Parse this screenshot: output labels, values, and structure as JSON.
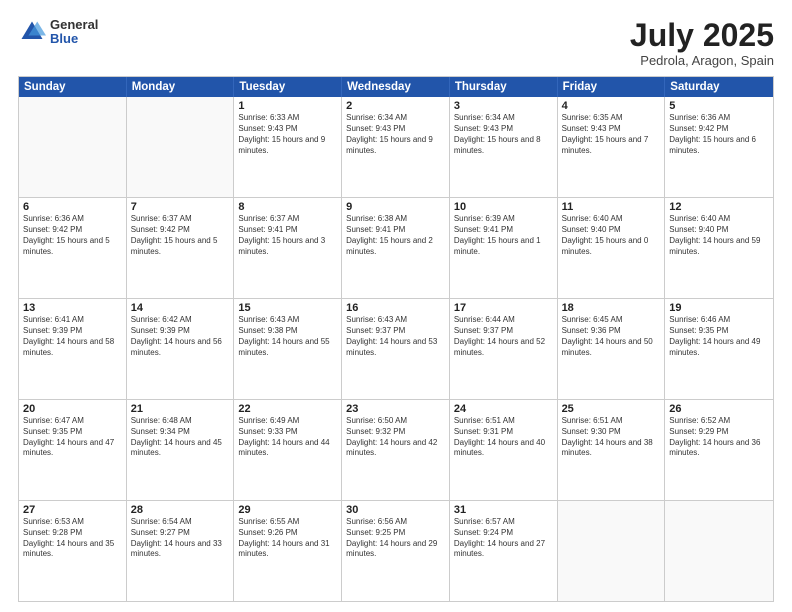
{
  "logo": {
    "general": "General",
    "blue": "Blue"
  },
  "title": {
    "month": "July 2025",
    "location": "Pedrola, Aragon, Spain"
  },
  "calendar": {
    "headers": [
      "Sunday",
      "Monday",
      "Tuesday",
      "Wednesday",
      "Thursday",
      "Friday",
      "Saturday"
    ],
    "rows": [
      [
        {
          "day": "",
          "text": ""
        },
        {
          "day": "",
          "text": ""
        },
        {
          "day": "1",
          "text": "Sunrise: 6:33 AM\nSunset: 9:43 PM\nDaylight: 15 hours and 9 minutes."
        },
        {
          "day": "2",
          "text": "Sunrise: 6:34 AM\nSunset: 9:43 PM\nDaylight: 15 hours and 9 minutes."
        },
        {
          "day": "3",
          "text": "Sunrise: 6:34 AM\nSunset: 9:43 PM\nDaylight: 15 hours and 8 minutes."
        },
        {
          "day": "4",
          "text": "Sunrise: 6:35 AM\nSunset: 9:43 PM\nDaylight: 15 hours and 7 minutes."
        },
        {
          "day": "5",
          "text": "Sunrise: 6:36 AM\nSunset: 9:42 PM\nDaylight: 15 hours and 6 minutes."
        }
      ],
      [
        {
          "day": "6",
          "text": "Sunrise: 6:36 AM\nSunset: 9:42 PM\nDaylight: 15 hours and 5 minutes."
        },
        {
          "day": "7",
          "text": "Sunrise: 6:37 AM\nSunset: 9:42 PM\nDaylight: 15 hours and 5 minutes."
        },
        {
          "day": "8",
          "text": "Sunrise: 6:37 AM\nSunset: 9:41 PM\nDaylight: 15 hours and 3 minutes."
        },
        {
          "day": "9",
          "text": "Sunrise: 6:38 AM\nSunset: 9:41 PM\nDaylight: 15 hours and 2 minutes."
        },
        {
          "day": "10",
          "text": "Sunrise: 6:39 AM\nSunset: 9:41 PM\nDaylight: 15 hours and 1 minute."
        },
        {
          "day": "11",
          "text": "Sunrise: 6:40 AM\nSunset: 9:40 PM\nDaylight: 15 hours and 0 minutes."
        },
        {
          "day": "12",
          "text": "Sunrise: 6:40 AM\nSunset: 9:40 PM\nDaylight: 14 hours and 59 minutes."
        }
      ],
      [
        {
          "day": "13",
          "text": "Sunrise: 6:41 AM\nSunset: 9:39 PM\nDaylight: 14 hours and 58 minutes."
        },
        {
          "day": "14",
          "text": "Sunrise: 6:42 AM\nSunset: 9:39 PM\nDaylight: 14 hours and 56 minutes."
        },
        {
          "day": "15",
          "text": "Sunrise: 6:43 AM\nSunset: 9:38 PM\nDaylight: 14 hours and 55 minutes."
        },
        {
          "day": "16",
          "text": "Sunrise: 6:43 AM\nSunset: 9:37 PM\nDaylight: 14 hours and 53 minutes."
        },
        {
          "day": "17",
          "text": "Sunrise: 6:44 AM\nSunset: 9:37 PM\nDaylight: 14 hours and 52 minutes."
        },
        {
          "day": "18",
          "text": "Sunrise: 6:45 AM\nSunset: 9:36 PM\nDaylight: 14 hours and 50 minutes."
        },
        {
          "day": "19",
          "text": "Sunrise: 6:46 AM\nSunset: 9:35 PM\nDaylight: 14 hours and 49 minutes."
        }
      ],
      [
        {
          "day": "20",
          "text": "Sunrise: 6:47 AM\nSunset: 9:35 PM\nDaylight: 14 hours and 47 minutes."
        },
        {
          "day": "21",
          "text": "Sunrise: 6:48 AM\nSunset: 9:34 PM\nDaylight: 14 hours and 45 minutes."
        },
        {
          "day": "22",
          "text": "Sunrise: 6:49 AM\nSunset: 9:33 PM\nDaylight: 14 hours and 44 minutes."
        },
        {
          "day": "23",
          "text": "Sunrise: 6:50 AM\nSunset: 9:32 PM\nDaylight: 14 hours and 42 minutes."
        },
        {
          "day": "24",
          "text": "Sunrise: 6:51 AM\nSunset: 9:31 PM\nDaylight: 14 hours and 40 minutes."
        },
        {
          "day": "25",
          "text": "Sunrise: 6:51 AM\nSunset: 9:30 PM\nDaylight: 14 hours and 38 minutes."
        },
        {
          "day": "26",
          "text": "Sunrise: 6:52 AM\nSunset: 9:29 PM\nDaylight: 14 hours and 36 minutes."
        }
      ],
      [
        {
          "day": "27",
          "text": "Sunrise: 6:53 AM\nSunset: 9:28 PM\nDaylight: 14 hours and 35 minutes."
        },
        {
          "day": "28",
          "text": "Sunrise: 6:54 AM\nSunset: 9:27 PM\nDaylight: 14 hours and 33 minutes."
        },
        {
          "day": "29",
          "text": "Sunrise: 6:55 AM\nSunset: 9:26 PM\nDaylight: 14 hours and 31 minutes."
        },
        {
          "day": "30",
          "text": "Sunrise: 6:56 AM\nSunset: 9:25 PM\nDaylight: 14 hours and 29 minutes."
        },
        {
          "day": "31",
          "text": "Sunrise: 6:57 AM\nSunset: 9:24 PM\nDaylight: 14 hours and 27 minutes."
        },
        {
          "day": "",
          "text": ""
        },
        {
          "day": "",
          "text": ""
        }
      ]
    ]
  }
}
